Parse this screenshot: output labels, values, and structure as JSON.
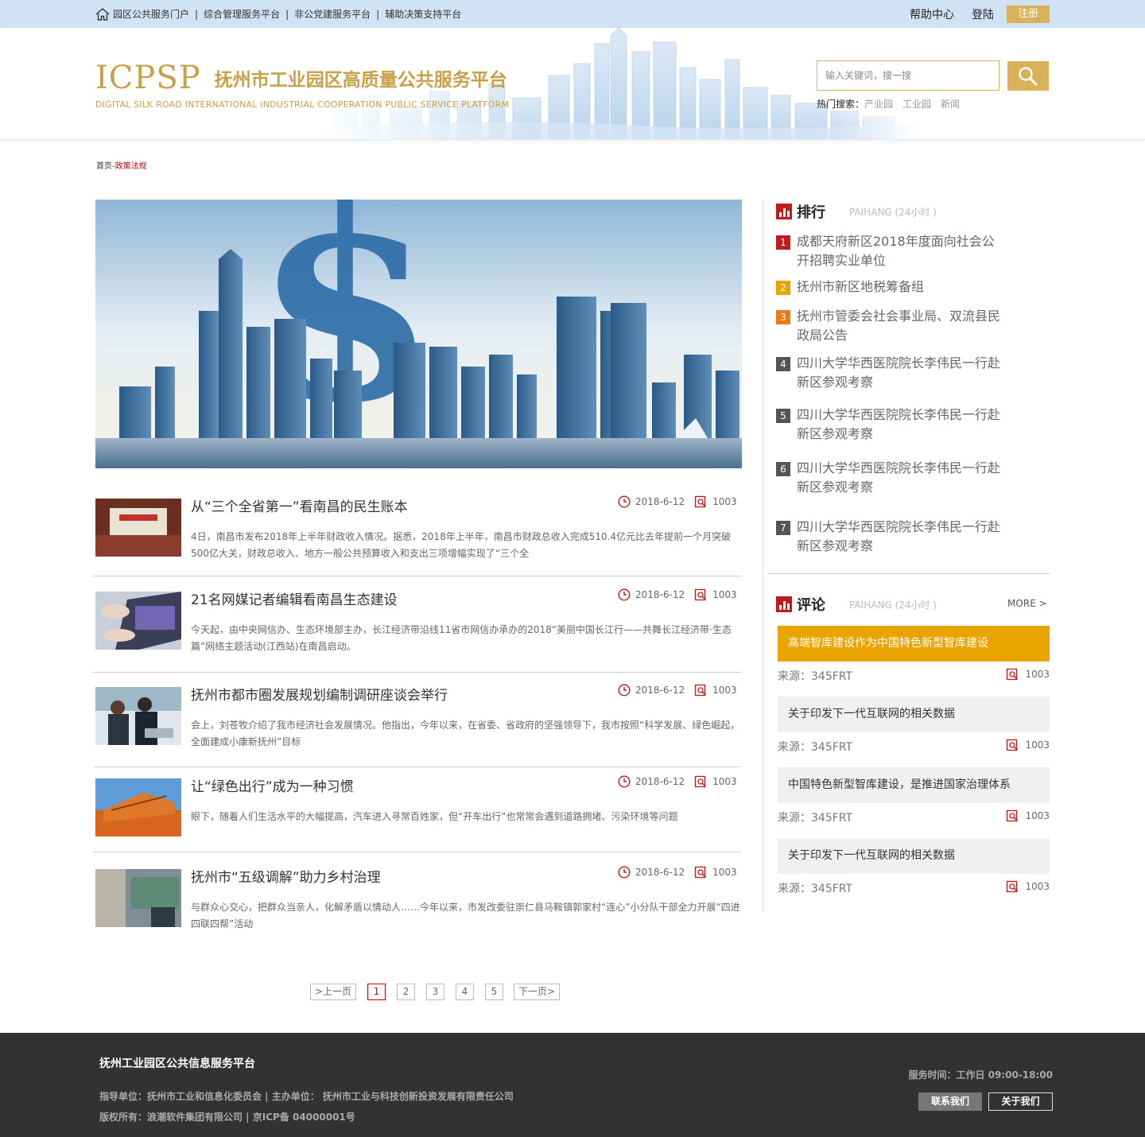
{
  "topbar": {
    "links": [
      "园区公共服务门户",
      "综合管理服务平台",
      "非公党建服务平台",
      "辅助决策支持平台"
    ],
    "help": "帮助中心",
    "login": "登陆",
    "register": "注册"
  },
  "header": {
    "logo_abbr": "ICPSP",
    "logo_cn": "抚州市工业园区高质量公共服务平台",
    "logo_en": "DIGITAL SILK ROAD INTERNATIONAL INDUSTRIAL COOPERATION PUBLIC SERVICE PLATFORM",
    "search_placeholder": "输入关键词，搜一搜",
    "hot_label": "热门搜索：",
    "hot_terms": [
      "产业园",
      "工业园",
      "新闻"
    ]
  },
  "breadcrumb": {
    "home": "首页",
    "sep": "-",
    "current": "政策法规"
  },
  "news": [
    {
      "title": "从“三个全省第一”看南昌的民生账本",
      "date": "2018-6-12",
      "count": "1003",
      "desc": "4日，南昌市发布2018年上半年财政收入情况。据悉，2018年上半年，南昌市财政总收入完成510.4亿元比去年提前一个月突破500亿大关，财政总收入、地方一般公共预算收入和支出三项增幅实现了“三个全"
    },
    {
      "title": "21名网媒记者编辑看南昌生态建设",
      "date": "2018-6-12",
      "count": "1003",
      "desc": "今天起，由中央网信办、生态环境部主办，长江经济带沿线11省市网信办承办的2018“美丽中国长江行——共舞长江经济带·生态篇”网络主题活动(江西站)在南昌启动。"
    },
    {
      "title": "抚州市都市圈发展规划编制调研座谈会举行",
      "date": "2018-6-12",
      "count": "1003",
      "desc": "会上，刘苍牧介绍了我市经济社会发展情况。他指出，今年以来，在省委、省政府的坚强领导下，我市按照“科学发展、绿色崛起，全面建成小康新抚州”目标"
    },
    {
      "title": "让“绿色出行”成为一种习惯",
      "date": "2018-6-12",
      "count": "1003",
      "desc": "眼下，随着人们生活水平的大幅提高，汽车进入寻常百姓家，但“开车出行”也常常会遇到道路拥堵、污染环境等问题"
    },
    {
      "title": "抚州市“五级调解”助力乡村治理",
      "date": "2018-6-12",
      "count": "1003",
      "desc": "与群众心交心，把群众当亲人，化解矛盾以情动人……今年以来，市发改委驻崇仁县马鞍镇郭家村“连心”小分队干部全力开展“四进四联四帮”活动"
    }
  ],
  "rank": {
    "title": "排行",
    "sub": "PAIHANG (24小时 )",
    "items": [
      {
        "num": "1",
        "text": "成都天府新区2018年度面向社会公开招聘实业单位",
        "color": "#c01a1a"
      },
      {
        "num": "2",
        "text": "抚州市新区地税筹备组",
        "color": "#e9a400"
      },
      {
        "num": "3",
        "text": "抚州市管委会社会事业局、双流县民政局公告",
        "color": "#ec7a14"
      },
      {
        "num": "4",
        "text": "四川大学华西医院院长李伟民一行赴新区参观考察",
        "color": "#555555"
      },
      {
        "num": "5",
        "text": "四川大学华西医院院长李伟民一行赴新区参观考察",
        "color": "#555555"
      },
      {
        "num": "6",
        "text": "四川大学华西医院院长李伟民一行赴新区参观考察",
        "color": "#555555"
      },
      {
        "num": "7",
        "text": "四川大学华西医院院长李伟民一行赴新区参观考察",
        "color": "#555555"
      }
    ]
  },
  "comments": {
    "title": "评论",
    "sub": "PAIHANG (24小时 )",
    "more": "MORE >",
    "items": [
      {
        "title": "高端智库建设作为中国特色新型智库建设",
        "source": "来源：345FRT",
        "count": "1003"
      },
      {
        "title": "关于印发下一代互联网的相关数据",
        "source": "来源：345FRT",
        "count": "1003"
      },
      {
        "title": "中国特色新型智库建设，是推进国家治理体系",
        "source": "来源：345FRT",
        "count": "1003"
      },
      {
        "title": "关于印发下一代互联网的相关数据",
        "source": "来源：345FRT",
        "count": "1003"
      }
    ]
  },
  "pagination": {
    "prev": ">上一页",
    "pages": [
      "1",
      "2",
      "3",
      "4",
      "5"
    ],
    "next": "下一页>",
    "current": "1"
  },
  "footer": {
    "name": "抚州工业园区公共信息服务平台",
    "line1": "指导单位：抚州市工业和信息化委员会 | 主办单位： 抚州市工业与科技创新投资发展有限责任公司",
    "line2": "版权所有：浪潮软件集团有限公司 | 京ICP备 04000001号",
    "service_time": "服务时间：工作日  09:00-18:00",
    "contact": "联系我们",
    "about": "关于我们"
  },
  "colors": {
    "gold": "#d9b158",
    "red": "#c01a1a",
    "orange": "#e9a400",
    "topbar": "#cfe3f5",
    "footer": "#323232"
  }
}
